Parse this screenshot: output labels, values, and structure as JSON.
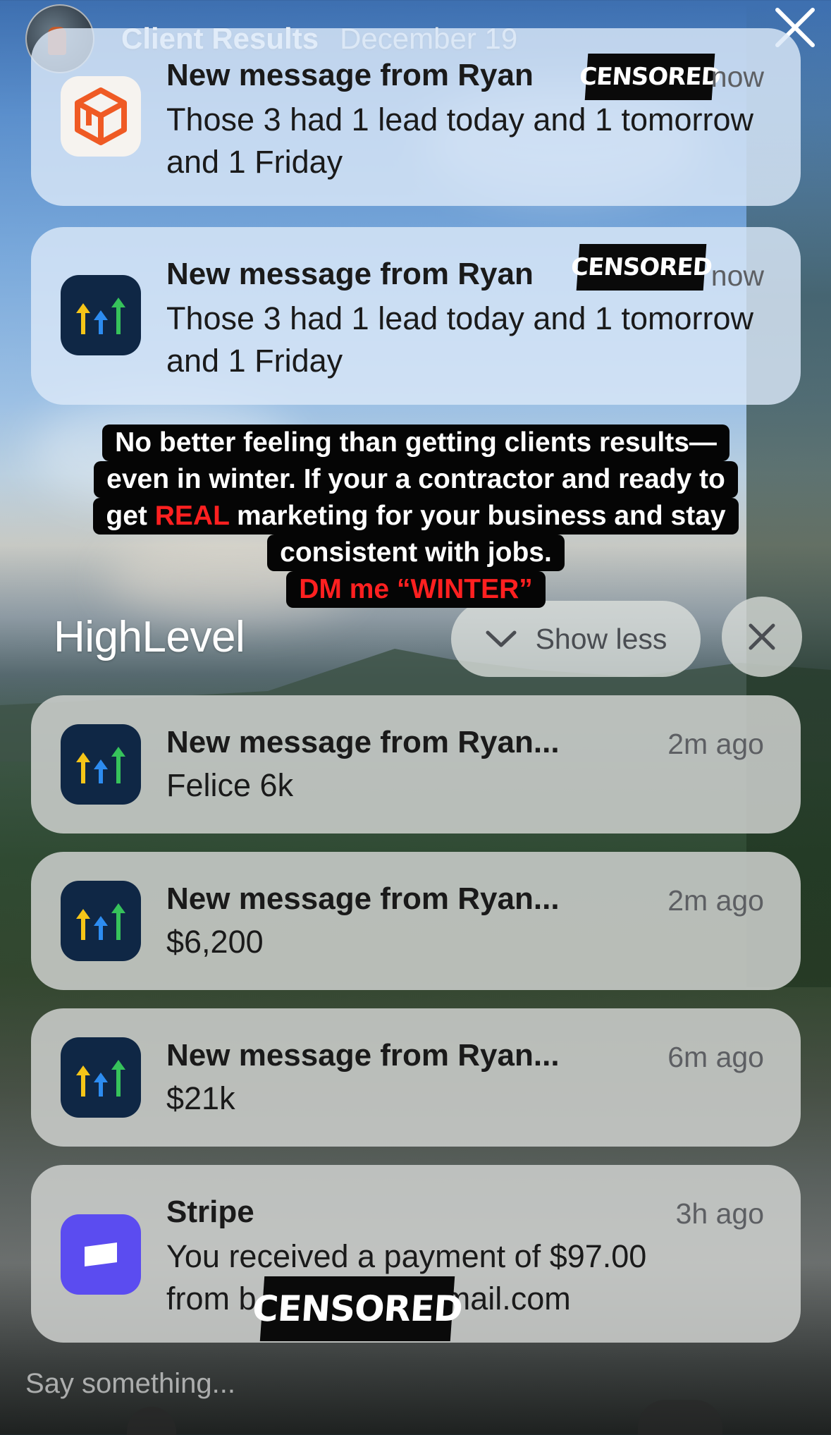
{
  "story": {
    "title": "Client Results",
    "date": "December 19"
  },
  "notifications_top": [
    {
      "app_icon": "box-logo-icon",
      "title": "New message from Ryan",
      "censor": "CENSORED",
      "time": "now",
      "body": "Those 3 had 1 lead today and 1 tomorrow and 1 Friday"
    },
    {
      "app_icon": "highlevel-arrows-icon",
      "title": "New message from Ryan",
      "censor": "CENSORED",
      "time": "now",
      "body": "Those 3 had 1 lead today and 1 tomorrow and 1 Friday"
    }
  ],
  "caption": {
    "line1": "No better feeling than getting  clients results—",
    "line2": "even in winter. If your a contractor and ready to",
    "line3_pre": "get ",
    "line3_red": "REAL",
    "line3_post": " marketing for your business and stay",
    "line4": "consistent with jobs.",
    "line5": "DM me “WINTER”"
  },
  "group": {
    "label": "HighLevel",
    "show_less": "Show less"
  },
  "notifications_group": [
    {
      "app_icon": "highlevel-arrows-icon",
      "title": "New message from Ryan...",
      "time": "2m ago",
      "body": "Felice 6k"
    },
    {
      "app_icon": "highlevel-arrows-icon",
      "title": "New message from Ryan...",
      "time": "2m ago",
      "body": "$6,200"
    },
    {
      "app_icon": "highlevel-arrows-icon",
      "title": "New message from Ryan...",
      "time": "6m ago",
      "body": "$21k"
    }
  ],
  "stripe": {
    "app_icon": "stripe-icon",
    "title": "Stripe",
    "time": "3h ago",
    "body_line1": "You received a payment of $97.00",
    "body_line2_pre": "from b",
    "body_line2_post": "se@gmail.com",
    "censor": "CENSORED"
  },
  "bottom": {
    "placeholder": "Say something..."
  },
  "colors": {
    "caption_red": "#ff2020",
    "stripe_purple": "#5b4cf0",
    "highlevel_bg": "#0f2745",
    "highlevel_yellow": "#f5c518",
    "highlevel_blue": "#2d8cf0",
    "highlevel_green": "#36c25b",
    "box_orange": "#ef5a24"
  }
}
